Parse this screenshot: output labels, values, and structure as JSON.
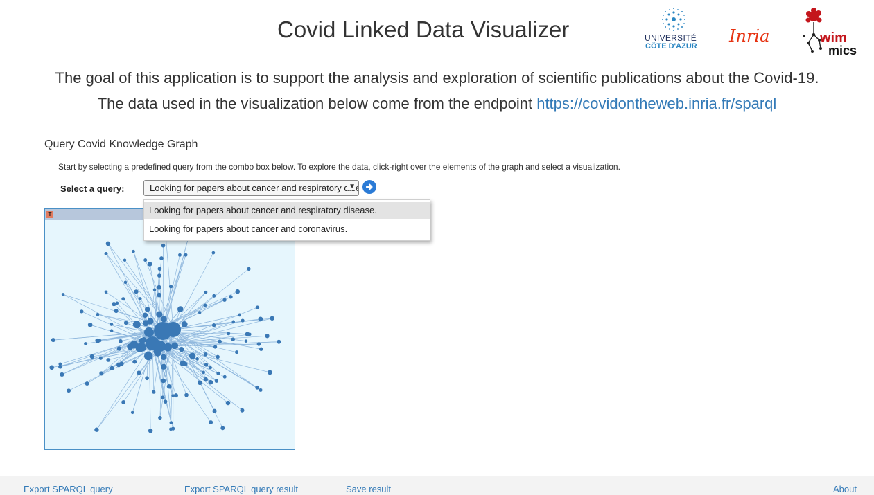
{
  "header": {
    "title": "Covid Linked Data Visualizer",
    "logos": {
      "uca_line1": "UNIVERSITÉ",
      "uca_line2": "CÔTE D'AZUR",
      "inria": "Inria",
      "wimmics_top": "wim",
      "wimmics_bottom": "mics"
    }
  },
  "intro": {
    "line1": "The goal of this application is to support the analysis and exploration of scientific publications about the Covid-19.",
    "line2_prefix": "The data used in the visualization below come from the endpoint ",
    "endpoint_link": "https://covidontheweb.inria.fr/sparql"
  },
  "section": {
    "title": "Query Covid Knowledge Graph",
    "instructions": "Start by selecting a predefined query from the combo box below. To explore the data, click-right over the elements of the graph and select a visualization."
  },
  "query": {
    "label": "Select a query:",
    "selected_value": "Looking for papers about cancer and respiratory disease.",
    "options": [
      "Looking for papers about cancer and respiratory disease.",
      "Looking for papers about cancer and coronavirus."
    ],
    "go_icon": "arrow-right-circle-icon"
  },
  "graph": {
    "badge": "T",
    "node_color": "#3a78b5",
    "edge_color": "#8fb7dd",
    "background": "#e6f6fd"
  },
  "footer": {
    "export_query": "Export SPARQL query",
    "export_result": "Export SPARQL query result",
    "save_result": "Save result",
    "about": "About"
  },
  "colors": {
    "link": "#337ab7",
    "inria_red": "#e63312",
    "uca_blue": "#2b86c2"
  }
}
